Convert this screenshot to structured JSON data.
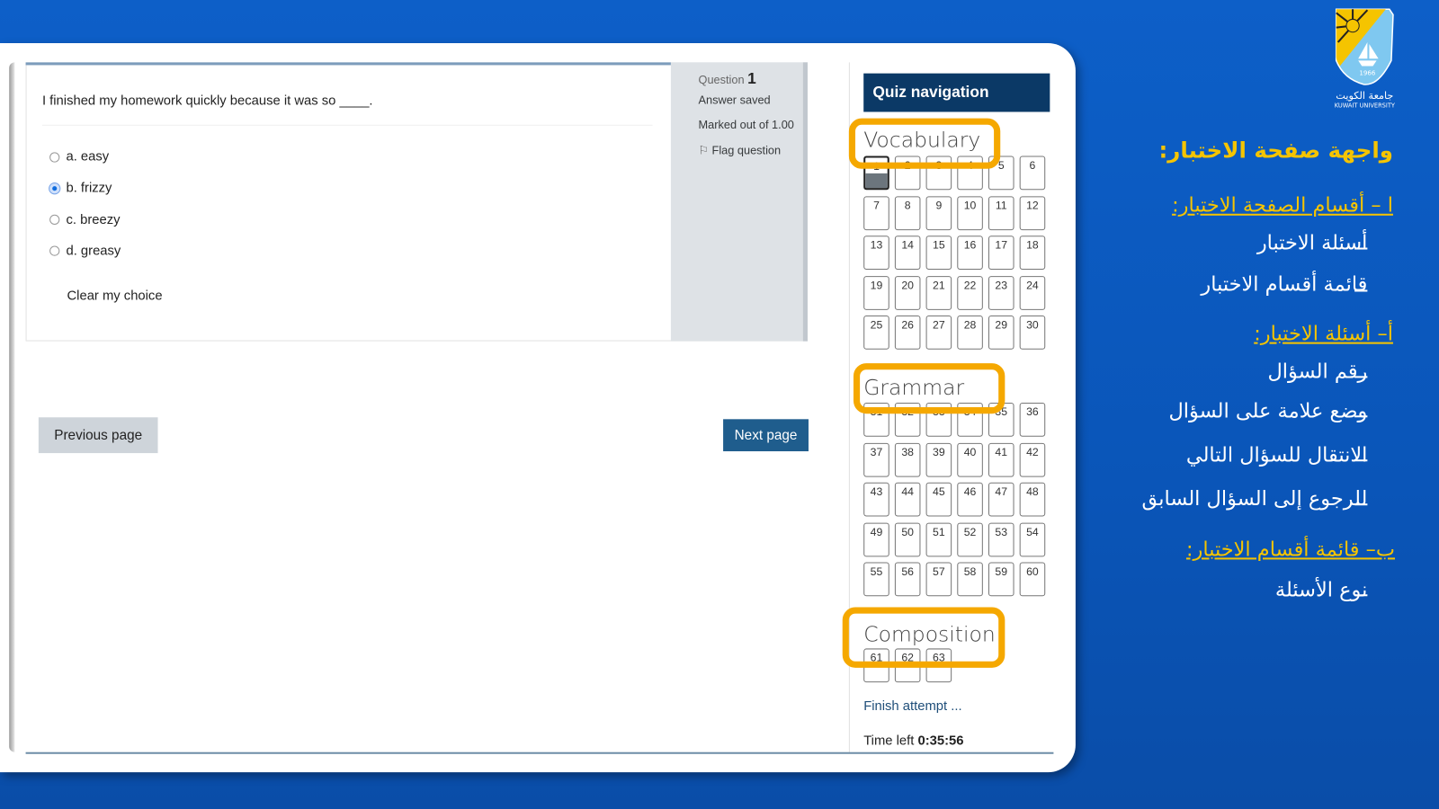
{
  "question": {
    "label": "Question",
    "number": "1",
    "state": "Answer saved",
    "marks": "Marked out of 1.00",
    "flag": "Flag question",
    "text": "I finished my homework quickly because it was so ____.",
    "options": [
      {
        "label": "a. easy",
        "selected": false
      },
      {
        "label": "b. frizzy",
        "selected": true
      },
      {
        "label": "c. breezy",
        "selected": false
      },
      {
        "label": "d. greasy",
        "selected": false
      }
    ],
    "clear": "Clear my choice"
  },
  "buttons": {
    "previous": "Previous page",
    "next": "Next page"
  },
  "nav": {
    "title": "Quiz navigation",
    "sections": [
      {
        "name": "Vocabulary",
        "questions": [
          "1",
          "2",
          "3",
          "4",
          "5",
          "6",
          "7",
          "8",
          "9",
          "10",
          "11",
          "12",
          "13",
          "14",
          "15",
          "16",
          "17",
          "18",
          "19",
          "20",
          "21",
          "22",
          "23",
          "24",
          "25",
          "26",
          "27",
          "28",
          "29",
          "30"
        ]
      },
      {
        "name": "Grammar",
        "questions": [
          "31",
          "32",
          "33",
          "34",
          "35",
          "36",
          "37",
          "38",
          "39",
          "40",
          "41",
          "42",
          "43",
          "44",
          "45",
          "46",
          "47",
          "48",
          "49",
          "50",
          "51",
          "52",
          "53",
          "54",
          "55",
          "56",
          "57",
          "58",
          "59",
          "60"
        ]
      },
      {
        "name": "Composition",
        "questions": [
          "61",
          "62",
          "63"
        ]
      }
    ],
    "current_question": "1",
    "finish": "Finish attempt ...",
    "time_label": "Time left",
    "time_value": "0:35:56"
  },
  "slide": {
    "logo": {
      "name": "جامعة الكويت",
      "name_en": "KUWAIT UNIVERSITY",
      "year": "1966"
    },
    "title": "واجهة  صفحة الاختبار:",
    "section1": "ا – أقسام الصفحة الاختبار:",
    "section1_items": [
      "أسئلة الاختبار",
      "قائمة أقسام الاختبار"
    ],
    "sectionA": "أ– أسئلة  الاختبار:",
    "sectionA_items": [
      "رقم السؤال",
      "وضع علامة على السؤال",
      "الانتقال للسؤال التالي",
      "للرجوع إلى السؤال السابق"
    ],
    "sectionB": "ب– قائمة أقسام الاختبار:",
    "sectionB_items": [
      "نوع الأسئلة"
    ]
  },
  "colors": {
    "highlight": "#f5a800",
    "nav_header": "#0b3966",
    "next_button": "#1f5d8d",
    "slide_bg": "#0d5fc8",
    "heading_yellow": "#f5c400"
  }
}
